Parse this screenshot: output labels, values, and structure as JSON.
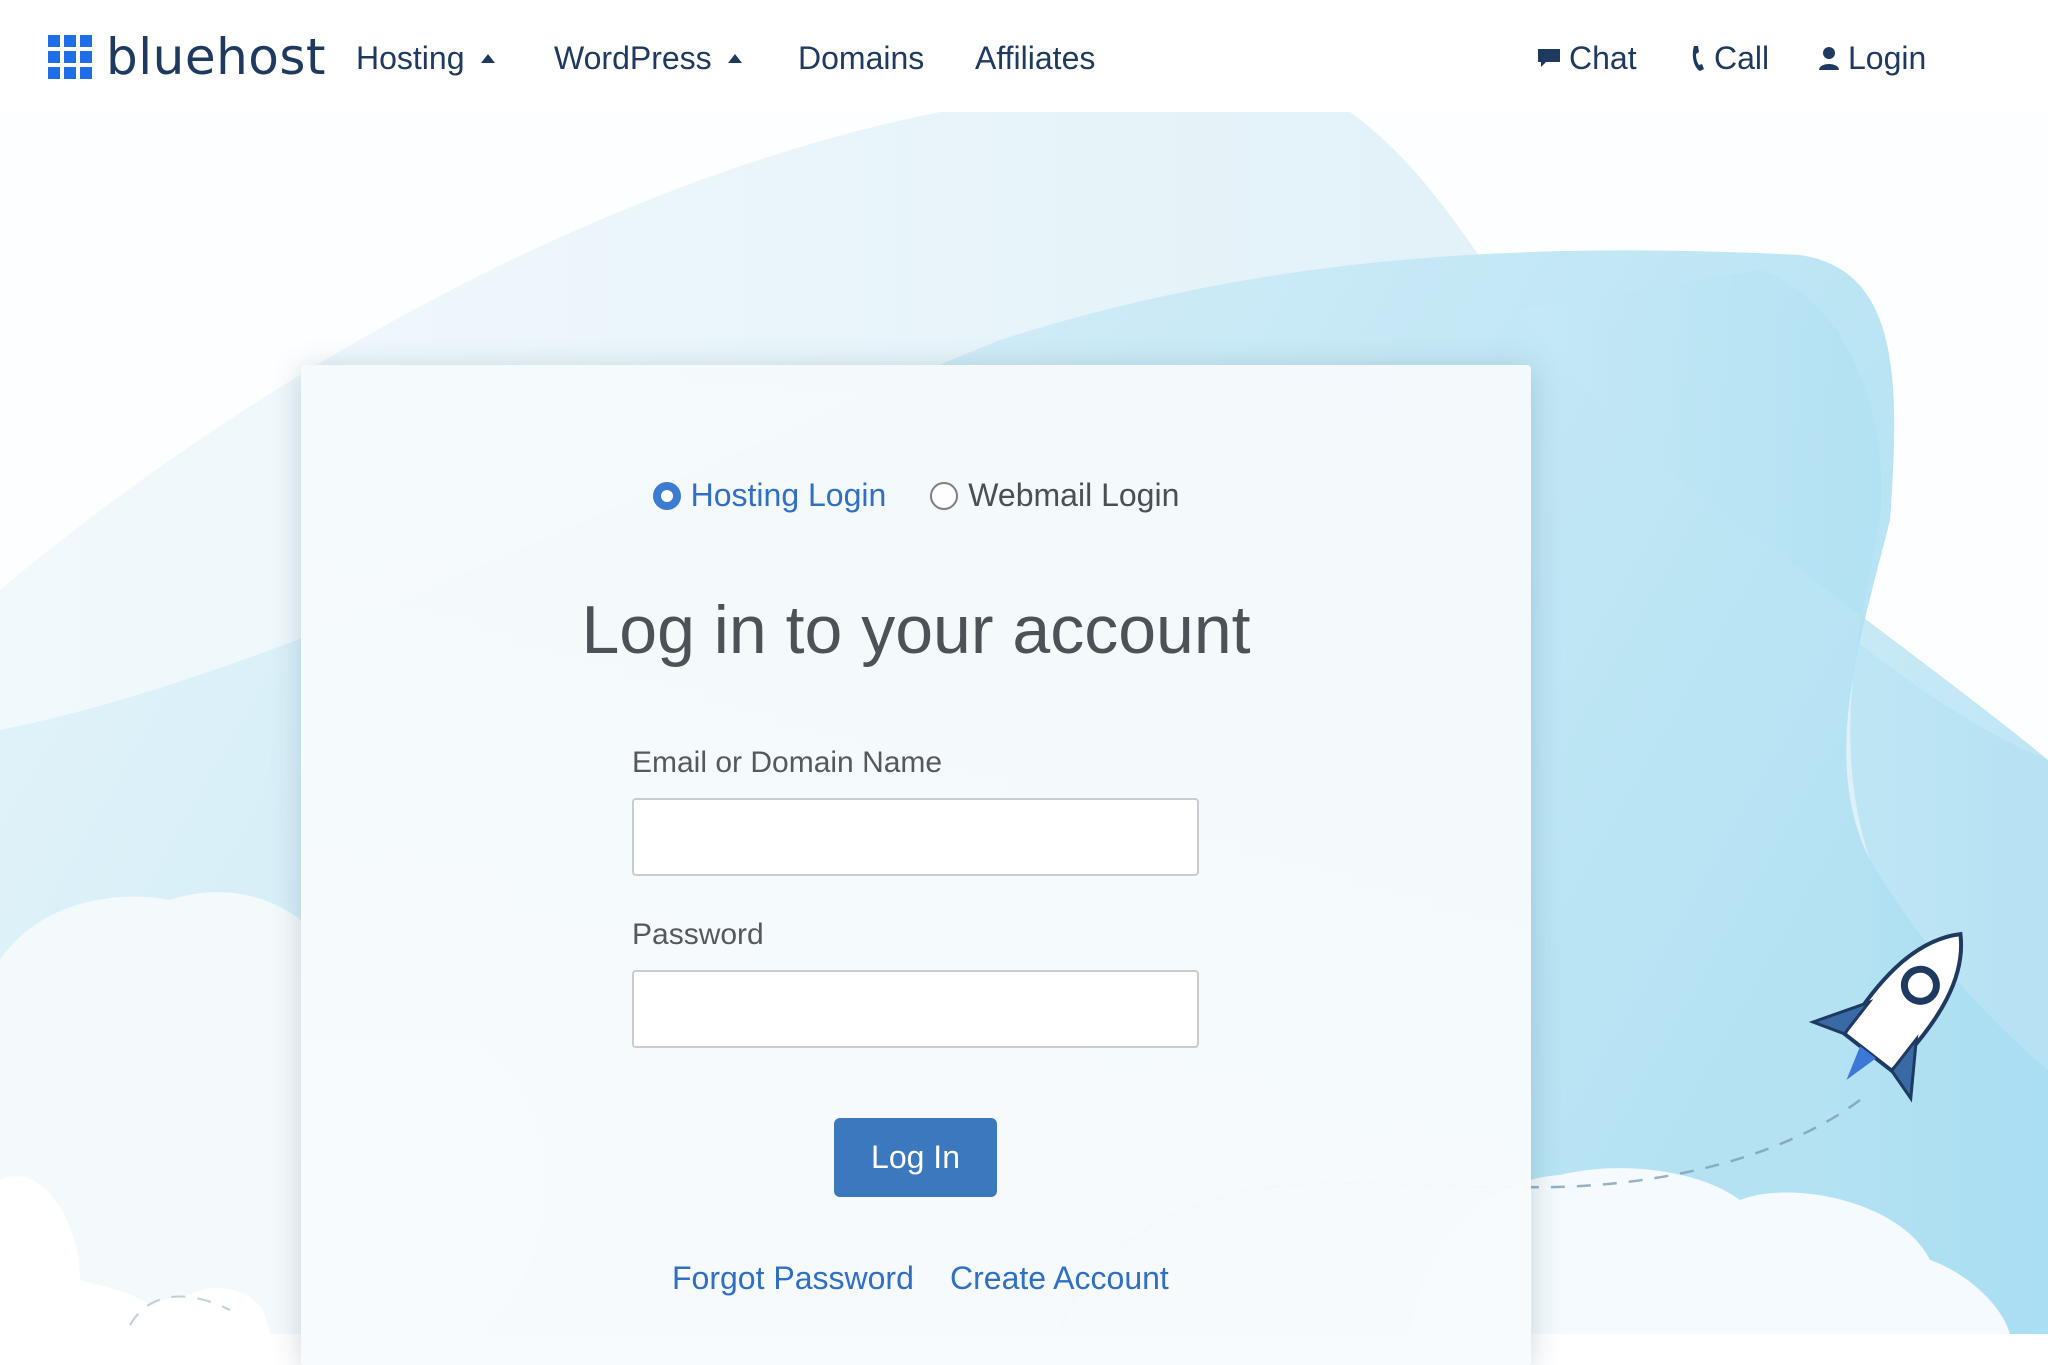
{
  "header": {
    "brand": "bluehost",
    "nav": [
      {
        "label": "Hosting"
      },
      {
        "label": "WordPress"
      },
      {
        "label": "Domains"
      },
      {
        "label": "Affiliates"
      }
    ],
    "utility": {
      "chat": "Chat",
      "call": "Call",
      "login": "Login"
    }
  },
  "login_card": {
    "login_type_options": [
      {
        "label": "Hosting Login",
        "selected": true
      },
      {
        "label": "Webmail Login",
        "selected": false
      }
    ],
    "title": "Log in to your account",
    "email_label": "Email or Domain Name",
    "email_value": "",
    "password_label": "Password",
    "password_value": "",
    "submit_label": "Log In",
    "forgot_password": "Forgot Password",
    "create_account": "Create Account"
  },
  "colors": {
    "brand_blue": "#1f6ee8",
    "nav_text": "#1f3a61",
    "link_blue": "#2f6fc5",
    "button_blue": "#3b78bd",
    "sky_light": "#e3f4fa",
    "sky_mid": "#b8e3f3"
  },
  "icons": [
    "logo-grid-icon",
    "caret-up-icon",
    "chat-bubble-icon",
    "phone-icon",
    "user-icon",
    "rocket-icon"
  ]
}
